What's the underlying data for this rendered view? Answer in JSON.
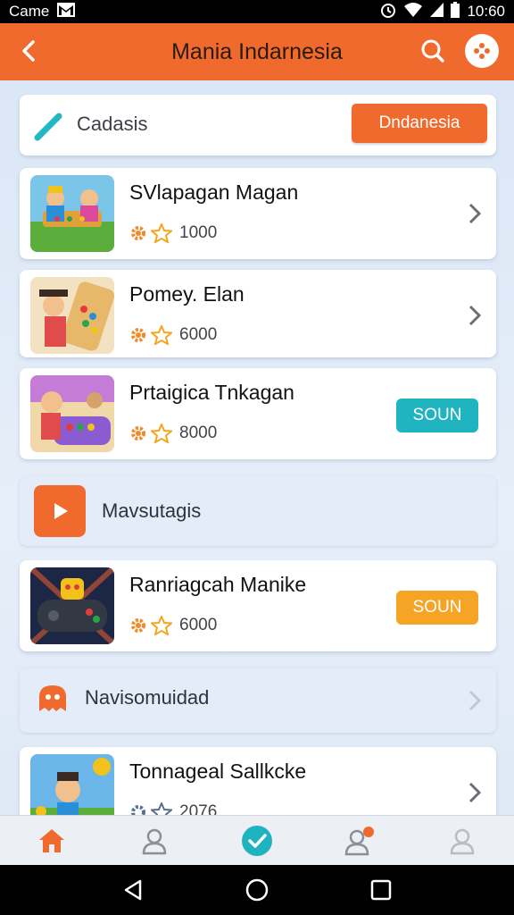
{
  "status_bar": {
    "carrier": "Came",
    "time": "10:60"
  },
  "app_bar": {
    "title": "Mania Indarnesia"
  },
  "category": {
    "label": "Cadasis",
    "button_label": "Dndanesia"
  },
  "games": [
    {
      "title": "SVlapagan Magan",
      "rating": "1000",
      "action": "chevron"
    },
    {
      "title": "Pomey. Elan",
      "rating": "6000",
      "action": "chevron"
    },
    {
      "title": "Prtaigica Tnkagan",
      "rating": "8000",
      "action": "SOUN"
    },
    {
      "title": "Ranriagcah Manike",
      "rating": "6000",
      "action": "SOUN"
    },
    {
      "title": "Tonnageal Sallkcke",
      "rating": "2076",
      "action": "chevron"
    }
  ],
  "sections": [
    {
      "label": "Mavsutagis"
    },
    {
      "label": "Navisomuidad"
    }
  ],
  "bottom_nav": [
    "home-icon",
    "profile-icon",
    "check-icon",
    "notifications-user-icon",
    "account-icon"
  ],
  "colors": {
    "accent": "#f06a2e",
    "teal": "#20b4c0",
    "amber": "#f6a426",
    "background": "#dbe6f4"
  }
}
